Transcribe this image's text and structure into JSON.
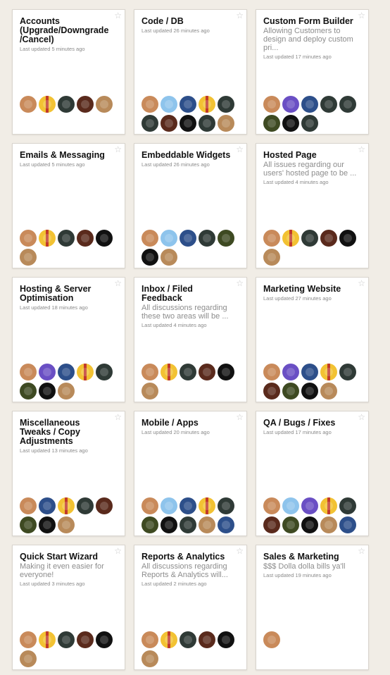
{
  "projects": [
    {
      "title": "Accounts (Upgrade/Downgrade /Cancel)",
      "description": "",
      "updated": "Last updated 5 minutes ago",
      "avatars": [
        "face-light",
        "stripe-yellow",
        "face-dark",
        "face-dark-red",
        "face-tan"
      ]
    },
    {
      "title": "Code / DB",
      "description": "",
      "updated": "Last updated 26 minutes ago",
      "avatars": [
        "face-light",
        "logo-blue",
        "face-blue",
        "stripe-yellow",
        "face-dark",
        "face-dark",
        "face-dark-red",
        "mask-black",
        "face-dark",
        "face-tan"
      ]
    },
    {
      "title": "Custom Form Builder",
      "description": "Allowing Customers to design and deploy custom pri...",
      "updated": "Last updated 17 minutes ago",
      "avatars": [
        "face-light",
        "logo-purple",
        "face-blue",
        "face-dark",
        "face-dark",
        "face-olive",
        "mask-black",
        "face-dark"
      ]
    },
    {
      "title": "Emails & Messaging",
      "description": "",
      "updated": "Last updated 5 minutes ago",
      "avatars": [
        "face-light",
        "stripe-yellow",
        "face-dark",
        "face-dark-red",
        "mask-black",
        "face-tan"
      ]
    },
    {
      "title": "Embeddable Widgets",
      "description": "",
      "updated": "Last updated 26 minutes ago",
      "avatars": [
        "face-light",
        "logo-blue",
        "face-blue",
        "face-dark",
        "face-olive",
        "mask-black",
        "face-tan"
      ]
    },
    {
      "title": "Hosted Page",
      "description": "All issues regarding our users' hosted page to be ...",
      "updated": "Last updated 4 minutes ago",
      "avatars": [
        "face-light",
        "stripe-yellow",
        "face-dark",
        "face-dark-red",
        "mask-black",
        "face-tan"
      ]
    },
    {
      "title": "Hosting & Server Optimisation",
      "description": "",
      "updated": "Last updated 18 minutes ago",
      "avatars": [
        "face-light",
        "logo-purple",
        "face-blue",
        "stripe-yellow",
        "face-dark",
        "face-olive",
        "mask-black",
        "face-tan"
      ]
    },
    {
      "title": "Inbox / Filed Feedback",
      "description": "All discussions regarding these two areas will be ...",
      "updated": "Last updated 4 minutes ago",
      "avatars": [
        "face-light",
        "stripe-yellow",
        "face-dark",
        "face-dark-red",
        "mask-black",
        "face-tan"
      ]
    },
    {
      "title": "Marketing Website",
      "description": "",
      "updated": "Last updated 27 minutes ago",
      "avatars": [
        "face-light",
        "logo-purple",
        "face-blue",
        "stripe-yellow",
        "face-dark",
        "face-dark-red",
        "face-olive",
        "mask-black",
        "face-tan"
      ]
    },
    {
      "title": "Miscellaneous Tweaks / Copy Adjustments",
      "description": "",
      "updated": "Last updated 13 minutes ago",
      "avatars": [
        "face-light",
        "face-blue",
        "stripe-yellow",
        "face-dark",
        "face-dark-red",
        "face-olive",
        "mask-black",
        "face-tan"
      ]
    },
    {
      "title": "Mobile / Apps",
      "description": "",
      "updated": "Last updated 20 minutes ago",
      "avatars": [
        "face-light",
        "logo-blue",
        "face-blue",
        "stripe-yellow",
        "face-dark",
        "face-olive",
        "mask-black",
        "face-dark",
        "face-tan",
        "face-blue"
      ]
    },
    {
      "title": "QA / Bugs / Fixes",
      "description": "",
      "updated": "Last updated 17 minutes ago",
      "avatars": [
        "face-light",
        "logo-blue",
        "logo-purple",
        "stripe-yellow",
        "face-dark",
        "face-dark-red",
        "face-olive",
        "mask-black",
        "face-tan",
        "face-blue"
      ]
    },
    {
      "title": "Quick Start Wizard",
      "description": "Making it even easier for everyone!",
      "updated": "Last updated 3 minutes ago",
      "avatars": [
        "face-light",
        "stripe-yellow",
        "face-dark",
        "face-dark-red",
        "mask-black",
        "face-tan"
      ]
    },
    {
      "title": "Reports & Analytics",
      "description": "All discussions regarding Reports & Analytics will...",
      "updated": "Last updated 2 minutes ago",
      "avatars": [
        "face-light",
        "stripe-yellow",
        "face-dark",
        "face-dark-red",
        "mask-black",
        "face-tan"
      ]
    },
    {
      "title": "Sales & Marketing",
      "description": "$$$ Dolla dolla bills ya'll",
      "updated": "Last updated 19 minutes ago",
      "avatars": [
        "face-light"
      ]
    }
  ],
  "avatar_colors": {
    "face-light": "#c98a5a",
    "stripe-yellow": "#f2c233",
    "face-dark": "#2f3a36",
    "face-dark-red": "#5a2a1c",
    "face-tan": "#b88a5a",
    "logo-blue": "#8ec4ec",
    "logo-purple": "#6a4fc4",
    "face-blue": "#2d4f8a",
    "face-olive": "#3e4a22",
    "mask-black": "#111111"
  },
  "icons": {
    "favorite": "star-outline-icon"
  }
}
